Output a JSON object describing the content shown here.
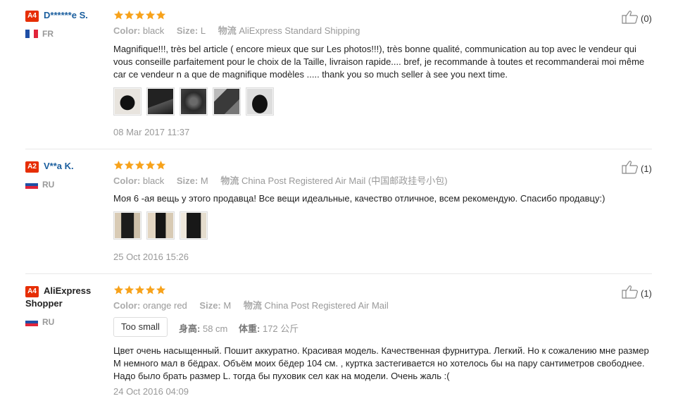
{
  "reviews": [
    {
      "badge": "A4",
      "name": "D******e S.",
      "country_code": "FR",
      "flag": "fr",
      "rating": 5,
      "color_label": "Color:",
      "color_value": "black",
      "size_label": "Size:",
      "size_value": "L",
      "logistics_label": "物流",
      "logistics_value": "AliExpress Standard Shipping",
      "text": "Magnifique!!!, très bel article ( encore mieux que sur Les photos!!!), très bonne qualité, communication au top avec le vendeur qui vous conseille parfaitement pour le choix de la Taille, livraison rapide.... bref, je recommande à toutes et recommanderai moi même car ce vendeur n a que de magnifique modèles ..... thank you so much seller à see you next time.",
      "photos": 5,
      "date": "08 Mar 2017 11:37",
      "likes": "(0)"
    },
    {
      "badge": "A2",
      "name": "V**a K.",
      "country_code": "RU",
      "flag": "ru",
      "rating": 5,
      "color_label": "Color:",
      "color_value": "black",
      "size_label": "Size:",
      "size_value": "M",
      "logistics_label": "物流",
      "logistics_value": "China Post Registered Air Mail (中国邮政挂号小包)",
      "text": "Моя 6 -ая вещь у этого продавца! Все вещи идеальные, качество отличное, всем рекомендую. Спасибо продавцу:)",
      "photos": 3,
      "date": "25 Oct 2016 15:26",
      "likes": "(1)"
    },
    {
      "badge": "A4",
      "name_line1": "AliExpress",
      "name_line2": "Shopper",
      "country_code": "RU",
      "flag": "ru",
      "rating": 5,
      "color_label": "Color:",
      "color_value": "orange red",
      "size_label": "Size:",
      "size_value": "M",
      "logistics_label": "物流",
      "logistics_value": "China Post Registered Air Mail",
      "fit": "Too small",
      "height_label": "身高:",
      "height_value": "58 cm",
      "weight_label": "体重:",
      "weight_value": "172 公斤",
      "text": "Цвет очень насыщенный. Пошит аккуратно. Красивая модель. Качественная фурнитура. Легкий. Но к сожалению мне размер M немного мал в бёдрах. Объём моих бёдер 104 см. , куртка застегивается но хотелось бы на пару сантиметров свободнее. Надо было брать размер L. тогда бы пуховик сел как на модели. Очень жаль :(",
      "date": "24 Oct 2016 04:09",
      "likes": "(1)"
    }
  ],
  "colors": {
    "star": "#f7a21b",
    "badge": "#e62e04",
    "username": "#1a5e9e"
  }
}
